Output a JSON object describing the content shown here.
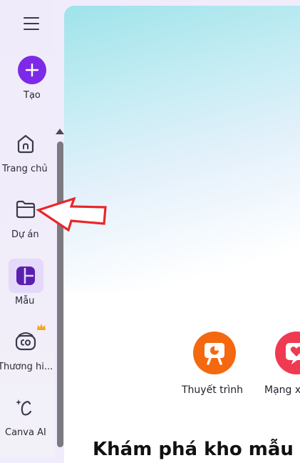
{
  "sidebar": {
    "create_label": "Tạo",
    "items": [
      {
        "label": "Trang chủ",
        "icon": "home-icon"
      },
      {
        "label": "Dự án",
        "icon": "folder-icon"
      },
      {
        "label": "Mẫu",
        "icon": "templates-icon"
      },
      {
        "label": "Thương hi...",
        "icon": "brand-icon"
      },
      {
        "label": "Canva AI",
        "icon": "canva-ai-icon"
      }
    ]
  },
  "main": {
    "categories": [
      {
        "label": "Thuyết trình",
        "icon": "presentation-icon",
        "color": "#f4690f"
      },
      {
        "label": "Mạng x",
        "icon": "social-heart-icon",
        "color": "#ef3a52"
      }
    ],
    "explore_title": "Khám phá kho mẫu"
  },
  "colors": {
    "accent": "#7d2ae8",
    "annotation_arrow": "#e8262a"
  }
}
